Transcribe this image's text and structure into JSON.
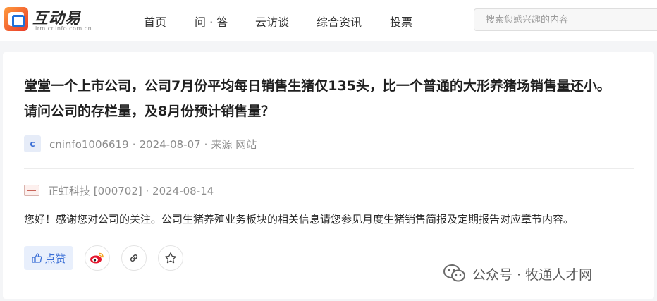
{
  "header": {
    "logo_text": "互动易",
    "logo_sub": "irm.cninfo.com.cn",
    "nav": [
      "首页",
      "问 · 答",
      "云访谈",
      "综合资讯",
      "投票"
    ],
    "search_placeholder": "搜索您感兴趣的内容"
  },
  "question": {
    "title": "堂堂一个上市公司，公司7月份平均每日销售生猪仅135头，比一个普通的大形养猪场销售量还小。请问公司的存栏量，及8月份预计销售量？",
    "avatar_letter": "c",
    "asker": "cninfo1006619",
    "date": "2024-08-07",
    "source": "来源 网站"
  },
  "reply": {
    "company": "正虹科技 [000702]",
    "date": "2024-08-14",
    "answer": "您好！感谢您对公司的关注。公司生猪养殖业务板块的相关信息请您参见月度生猪销售简报及定期报告对应章节内容。"
  },
  "actions": {
    "like_label": "点赞"
  },
  "watermark": {
    "text": "公众号 · 牧通人才网"
  },
  "colors": {
    "accent": "#3b6fd6",
    "like_bg": "#e8effc",
    "meta": "#8c8c8c"
  }
}
